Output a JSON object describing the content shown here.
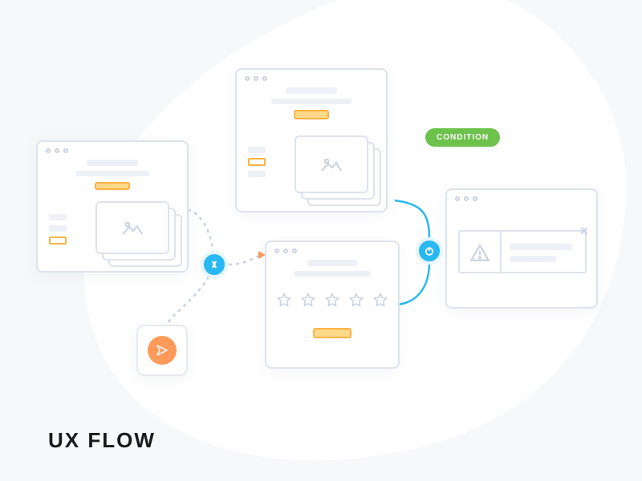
{
  "title": "UX FLOW",
  "badge": {
    "label": "CONDITION",
    "color": "#6cc24a"
  },
  "nodes": {
    "merge": "merge-node",
    "power": "conditional-node",
    "send": "send-action"
  },
  "panels": {
    "left_gallery": {
      "type": "wireframe-window",
      "has_image_stack": true,
      "option_count": 3,
      "selected_option_index": 2
    },
    "top_gallery": {
      "type": "wireframe-window",
      "has_image_stack": true,
      "has_cta": true,
      "option_count": 3,
      "selected_option_index": 1
    },
    "rating": {
      "type": "wireframe-window",
      "star_count": 5,
      "has_cta": true
    },
    "alert": {
      "type": "alert-dialog",
      "icon": "warning",
      "lines": 2,
      "dismissible": true
    }
  },
  "colors": {
    "accent_orange": "#ffb246",
    "accent_blue": "#29b9f2",
    "line": "#dde3ec",
    "bg": "#f7f8fa"
  }
}
